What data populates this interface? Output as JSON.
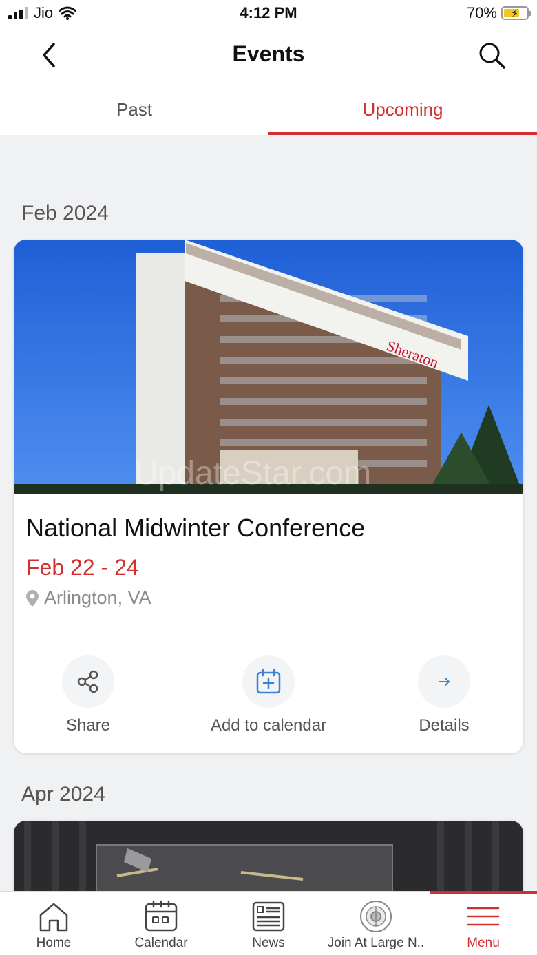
{
  "status": {
    "carrier": "Jio",
    "time": "4:12 PM",
    "battery": "70%"
  },
  "header": {
    "title": "Events"
  },
  "tabs": [
    {
      "label": "Past"
    },
    {
      "label": "Upcoming"
    }
  ],
  "sections": [
    {
      "month": "Feb 2024",
      "event": {
        "title": "National Midwinter Conference",
        "date": "Feb  22 - 24",
        "location": "Arlington, VA",
        "watermark": "UpdateStar.com"
      }
    },
    {
      "month": "Apr 2024"
    }
  ],
  "actions": {
    "share": "Share",
    "calendar": "Add to calendar",
    "details": "Details"
  },
  "bottom_nav": [
    {
      "label": "Home"
    },
    {
      "label": "Calendar"
    },
    {
      "label": "News"
    },
    {
      "label": "Join At Large N.."
    },
    {
      "label": "Menu"
    }
  ],
  "colors": {
    "accent": "#d32f2f",
    "icon_blue": "#3b82d6"
  }
}
